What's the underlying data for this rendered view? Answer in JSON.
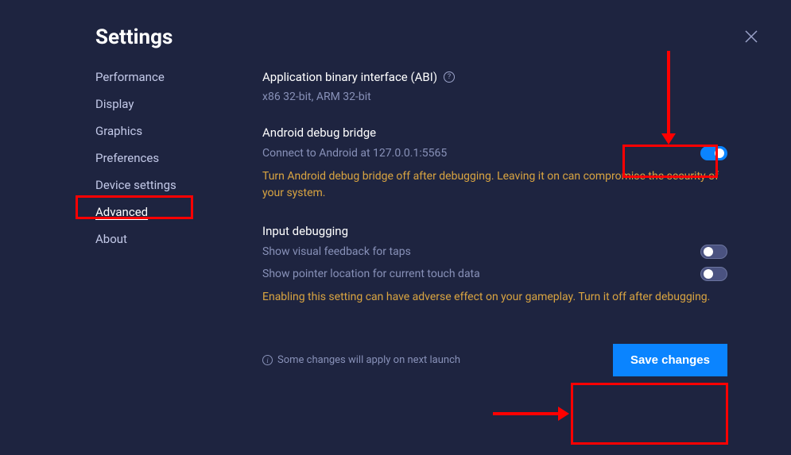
{
  "title": "Settings",
  "sidebar": {
    "items": [
      {
        "label": "Performance",
        "active": false
      },
      {
        "label": "Display",
        "active": false
      },
      {
        "label": "Graphics",
        "active": false
      },
      {
        "label": "Preferences",
        "active": false
      },
      {
        "label": "Device settings",
        "active": false
      },
      {
        "label": "Advanced",
        "active": true
      },
      {
        "label": "About",
        "active": false
      }
    ]
  },
  "sections": {
    "abi": {
      "title": "Application binary interface (ABI)",
      "value": "x86 32-bit, ARM 32-bit"
    },
    "adb": {
      "title": "Android debug bridge",
      "description": "Connect to Android at 127.0.0.1:5565",
      "toggle_on": true,
      "warning": "Turn Android debug bridge off after debugging. Leaving it on can compromise the security of your system."
    },
    "input_debugging": {
      "title": "Input debugging",
      "rows": [
        {
          "label": "Show visual feedback for taps",
          "on": false
        },
        {
          "label": "Show pointer location for current touch data",
          "on": false
        }
      ],
      "warning": "Enabling this setting can have adverse effect on your gameplay. Turn it off after  debugging."
    }
  },
  "footer": {
    "note": "Some changes will apply on next launch",
    "save_label": "Save changes"
  }
}
